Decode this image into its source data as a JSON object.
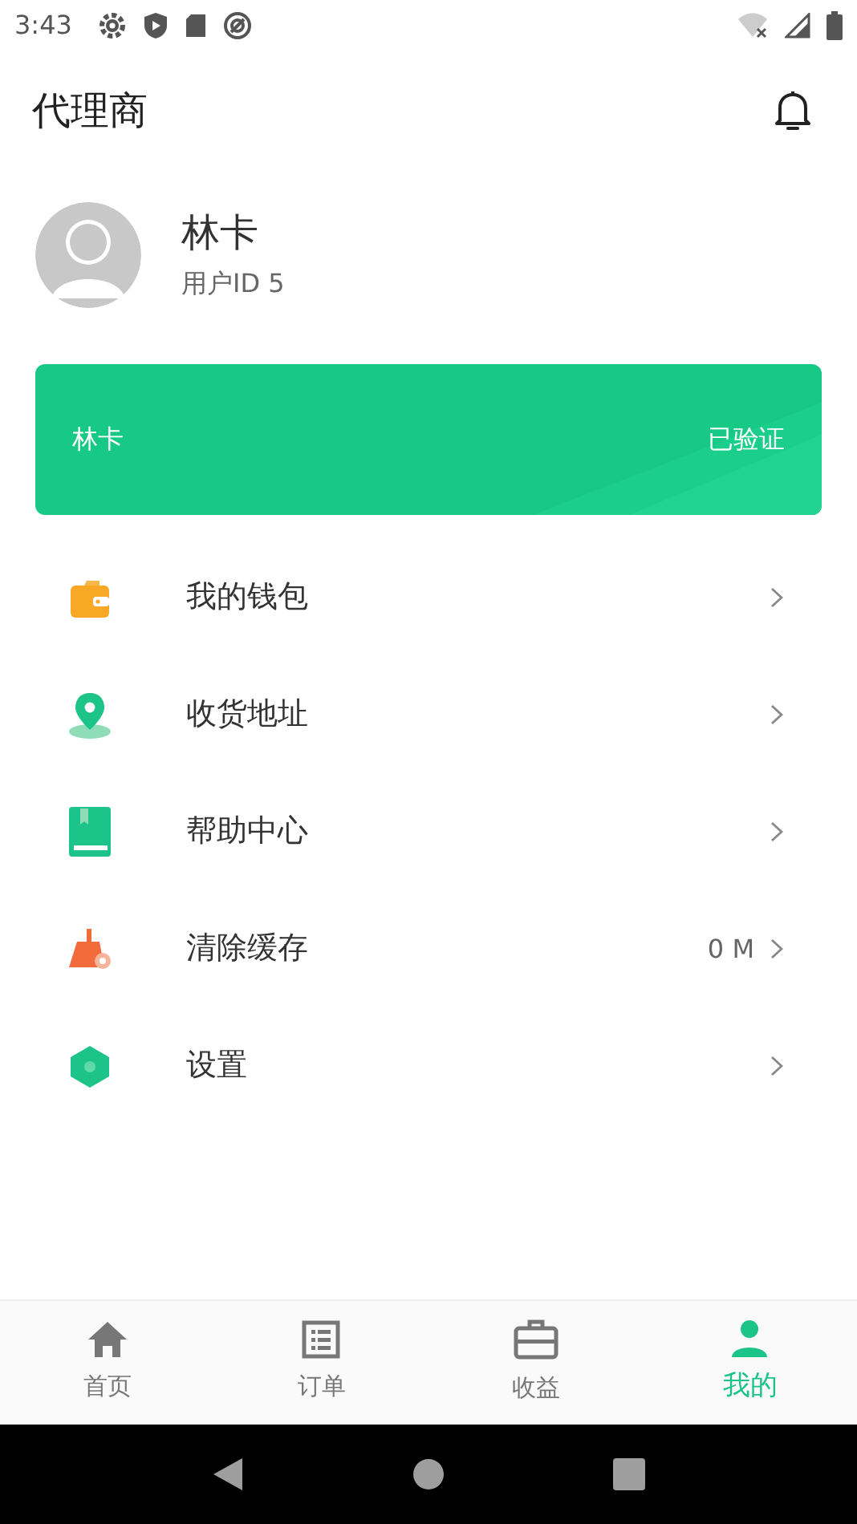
{
  "status_bar": {
    "time": "3:43"
  },
  "header": {
    "title": "代理商"
  },
  "profile": {
    "name": "林卡",
    "user_id": "用户ID 5"
  },
  "card": {
    "name": "林卡",
    "status": "已验证"
  },
  "menu": [
    {
      "kind": "wallet",
      "label": "我的钱包"
    },
    {
      "kind": "location",
      "label": "收货地址"
    },
    {
      "kind": "help",
      "label": "帮助中心"
    },
    {
      "kind": "cache",
      "label": "清除缓存",
      "value": "0 M"
    },
    {
      "kind": "settings",
      "label": "设置"
    }
  ],
  "tabs": [
    {
      "kind": "home",
      "label": "首页",
      "selected": false
    },
    {
      "kind": "orders",
      "label": "订单",
      "selected": false
    },
    {
      "kind": "earnings",
      "label": "收益",
      "selected": false
    },
    {
      "kind": "mine",
      "label": "我的",
      "selected": true
    }
  ]
}
